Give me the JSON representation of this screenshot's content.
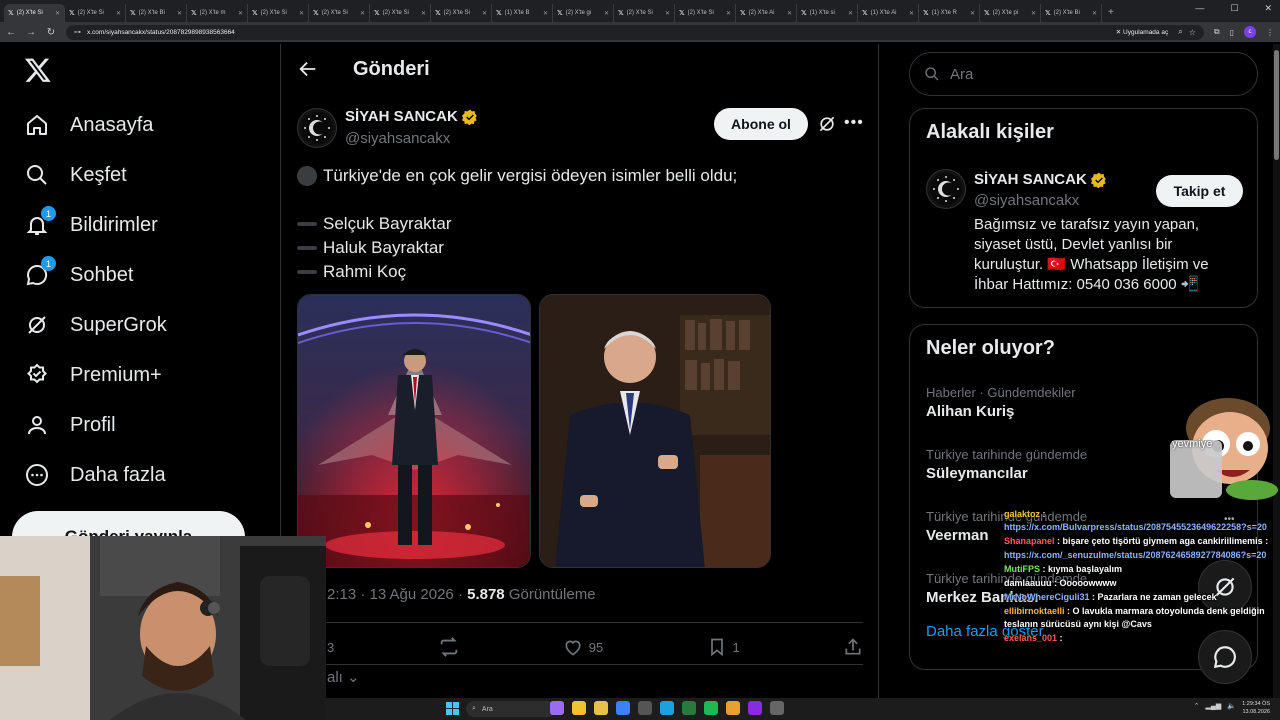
{
  "browser": {
    "tabs": [
      {
        "label": "(2) X'te Si"
      },
      {
        "label": "(2) X'te Si"
      },
      {
        "label": "(2) X'te Bi"
      },
      {
        "label": "(2) X'te m"
      },
      {
        "label": "(2) X'te Si"
      },
      {
        "label": "(2) X'te Si"
      },
      {
        "label": "(2) X'te Si"
      },
      {
        "label": "(2) X'te Si"
      },
      {
        "label": "(1) X'te B"
      },
      {
        "label": "(2) X'te gı"
      },
      {
        "label": "(2) X'te Si"
      },
      {
        "label": "(2) X'te Si"
      },
      {
        "label": "(2) X'te Ai"
      },
      {
        "label": "(1) X'te si"
      },
      {
        "label": "(1) X'te Ai"
      },
      {
        "label": "(1) X'te R"
      },
      {
        "label": "(2) X'te pi"
      },
      {
        "label": "(2) X'te Bi"
      }
    ],
    "url": "x.com/siyahsancakx/status/2087829898938563664",
    "open_app_label": "Uygulamada aç"
  },
  "nav": {
    "items": [
      {
        "label": "Anasayfa",
        "icon": "home-icon"
      },
      {
        "label": "Keşfet",
        "icon": "search-icon"
      },
      {
        "label": "Bildirimler",
        "icon": "bell-icon",
        "badge": "1"
      },
      {
        "label": "Sohbet",
        "icon": "chat-icon",
        "badge": "1"
      },
      {
        "label": "SuperGrok",
        "icon": "grok-icon"
      },
      {
        "label": "Premium+",
        "icon": "premium-icon"
      },
      {
        "label": "Profil",
        "icon": "profile-icon"
      },
      {
        "label": "Daha fazla",
        "icon": "more-icon"
      }
    ],
    "post_button": "Gönderi yayınla"
  },
  "header": {
    "title": "Gönderi"
  },
  "post": {
    "name": "SİYAH SANCAK",
    "handle": "@siyahsancakx",
    "subscribe": "Abone ol",
    "line1": "Türkiye'de en çok gelir vergisi ödeyen isimler belli oldu;",
    "names": [
      "Selçuk Bayraktar",
      "Haluk Bayraktar",
      "Rahmi Koç"
    ],
    "time": "2:13 · 13 Ağu 2026 · ",
    "views": "5.878",
    "views_label": " Görüntüleme",
    "counts": {
      "reply": "3",
      "like": "95",
      "bookmark": "1"
    },
    "relevant": "alı"
  },
  "right": {
    "search_placeholder": "Ara",
    "relevant_title": "Alakalı kişiler",
    "person": {
      "name": "SİYAH SANCAK",
      "handle": "@siyahsancakx",
      "follow": "Takip et",
      "bio": "Bağımsız ve tarafsız yayın yapan, siyaset üstü, Devlet yanlısı bir kuruluştur. 🇹🇷 Whatsapp İletişim ve İhbar Hattımız: 0540 036 6000 📲"
    },
    "happening_title": "Neler oluyor?",
    "trends": [
      {
        "context": "Haberler · Gündemdekiler",
        "title": "Alihan Kuriş"
      },
      {
        "context": "Türkiye tarihinde gündemde",
        "title": "Süleymancılar"
      },
      {
        "context": "Türkiye tarihinde gündemde",
        "title": "Veerman"
      },
      {
        "context": "Türkiye tarihinde gündemde",
        "title": "Merkez Bankası"
      }
    ],
    "show_more": "Daha fazla göster"
  },
  "stream": {
    "mascot_label": "yevmiye",
    "chat": [
      {
        "user": "galaktoz",
        "color": "#f5c542",
        "text": " : ",
        "link": "https://x.com/Bulvarpress/status/2087545523649622258?s=20"
      },
      {
        "user": "Shanapanel",
        "color": "#ff5a5a",
        "text": " : bişare çeto tişörtü giymem aga cankiriilimemis :",
        "link": ""
      },
      {
        "user": "",
        "color": "#fff",
        "text": "",
        "link": "https://x.com/_senuzulme/status/2087624658927784086?s=20"
      },
      {
        "user": "MutiFPS",
        "color": "#7ee36b",
        "text": " : kıyma başlayalım",
        "link": ""
      },
      {
        "user": "damlaauuu",
        "color": "#fff",
        "text": " : Ooooowwww",
        "link": ""
      },
      {
        "user": "MrNoWhereCiguli31",
        "color": "#8fb2ff",
        "text": " : Pazarlara ne zaman gelecek",
        "link": ""
      },
      {
        "user": "ellibirnoktaelli",
        "color": "#ffb347",
        "text": " : O lavukla marmara otoyolunda denk geldiğin teslanın sürücüsü aynı kişi @Cavs",
        "link": ""
      },
      {
        "user": "exelans_001",
        "color": "#ff5a5a",
        "text": " : ",
        "link": ""
      }
    ]
  },
  "taskbar": {
    "search": "Ara",
    "time": "1:29:34 ÖS",
    "date": "13.08.2026"
  }
}
